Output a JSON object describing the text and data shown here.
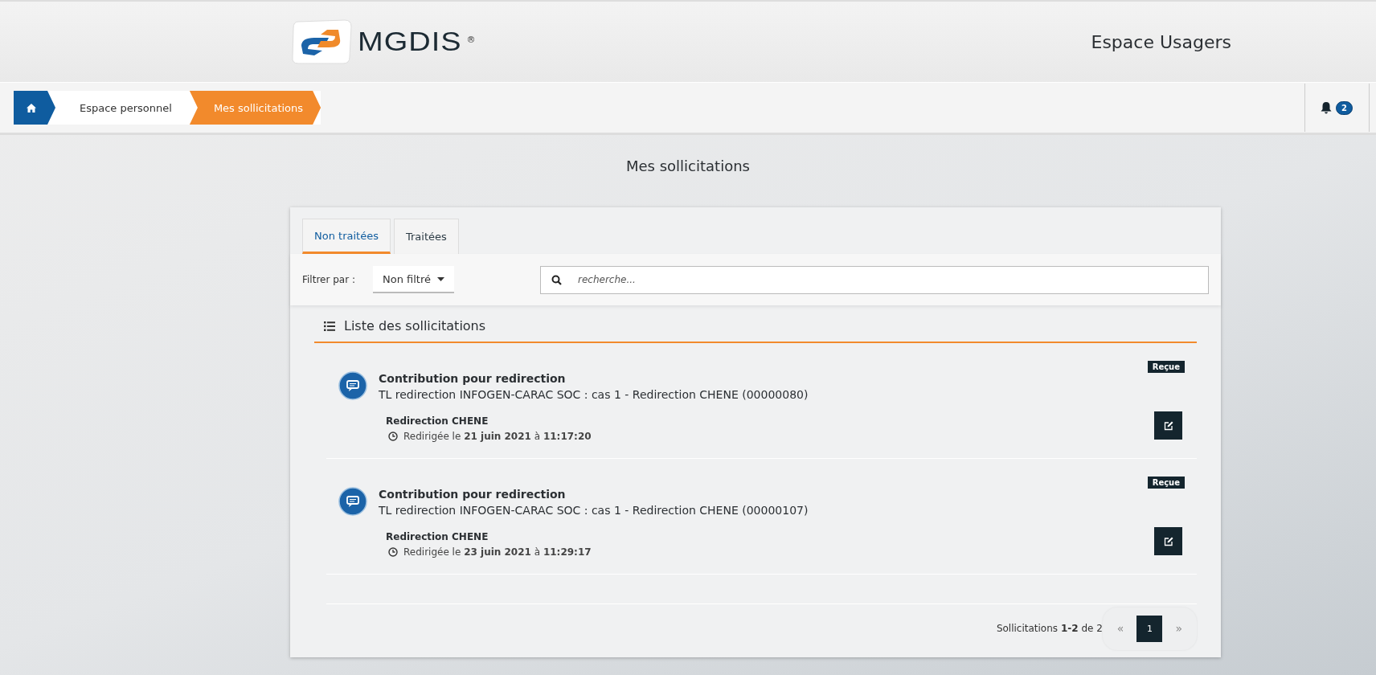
{
  "header": {
    "logo_text": "MGDIS",
    "logo_mark": "®",
    "title": "Espace Usagers"
  },
  "breadcrumb": [
    {
      "kind": "home",
      "selected": false
    },
    {
      "kind": "text",
      "label": "Espace personnel",
      "selected": false
    },
    {
      "kind": "text",
      "label": "Mes sollicitations",
      "selected": true
    }
  ],
  "notifications": {
    "count": "2"
  },
  "page_title": "Mes sollicitations",
  "tabs": [
    {
      "label": "Non traitées",
      "selected": true
    },
    {
      "label": "Traitées",
      "selected": false
    }
  ],
  "filter": {
    "label": "Filtrer par :",
    "value": "Non filtré"
  },
  "search": {
    "placeholder": "recherche..."
  },
  "list": {
    "title": "Liste des sollicitations",
    "items": [
      {
        "title": "Contribution pour redirection",
        "subtitle": "TL redirection INFOGEN-CARAC SOC : cas 1 - Redirection CHENE (00000080)",
        "status": "Reçue",
        "assignee": "Redirection CHENE",
        "date": "Redirigée le **21 juin 2021** à **11:17:20**"
      },
      {
        "title": "Contribution pour redirection",
        "subtitle": "TL redirection INFOGEN-CARAC SOC : cas 1 - Redirection CHENE (00000107)",
        "status": "Reçue",
        "assignee": "Redirection CHENE",
        "date": "Redirigée le **23 juin 2021** à **11:29:17**"
      }
    ]
  },
  "pagination": {
    "summary": "Sollicitations **1-2** de 2",
    "pages": [
      {
        "label": "«",
        "kind": "prev",
        "disabled": true
      },
      {
        "label": "1",
        "kind": "page",
        "selected": true
      },
      {
        "label": "»",
        "kind": "next",
        "disabled": true
      }
    ]
  }
}
